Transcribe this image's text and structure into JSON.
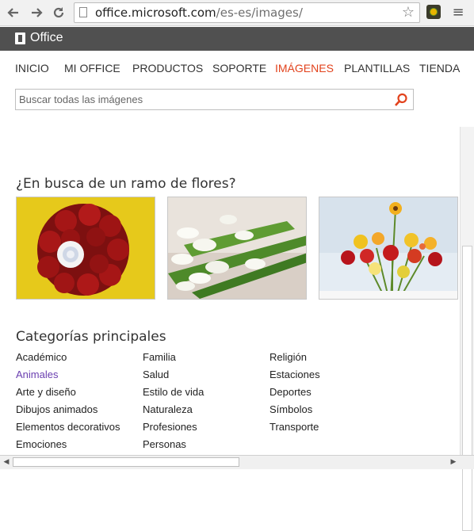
{
  "browser": {
    "url_domain": "office.microsoft.com",
    "url_path": "/es-es/images/",
    "back_icon": "arrow-left",
    "forward_icon": "arrow-right",
    "reload_icon": "reload",
    "star_icon": "star-outline",
    "menu_icon": "hamburger"
  },
  "office_bar": {
    "brand": "Office",
    "bg_color": "#505050"
  },
  "nav": {
    "items": [
      "INICIO",
      "MI OFFICE",
      "PRODUCTOS",
      "SOPORTE",
      "IMÁGENES",
      "PLANTILLAS",
      "TIENDA"
    ],
    "active_color": "#e2421c"
  },
  "search": {
    "placeholder": "Buscar todas las imágenes"
  },
  "featured": {
    "title": "¿En busca de un ramo de flores?"
  },
  "categories": {
    "title": "Categorías principales",
    "col1": [
      "Académico",
      "Animales",
      "Arte y diseño",
      "Dibujos animados",
      "Elementos decorativos",
      "Emociones"
    ],
    "col2": [
      "Familia",
      "Salud",
      "Estilo de vida",
      "Naturaleza",
      "Profesiones",
      "Personas"
    ],
    "col3": [
      "Religión",
      "Estaciones",
      "Deportes",
      "Símbolos",
      "Transporte"
    ]
  }
}
